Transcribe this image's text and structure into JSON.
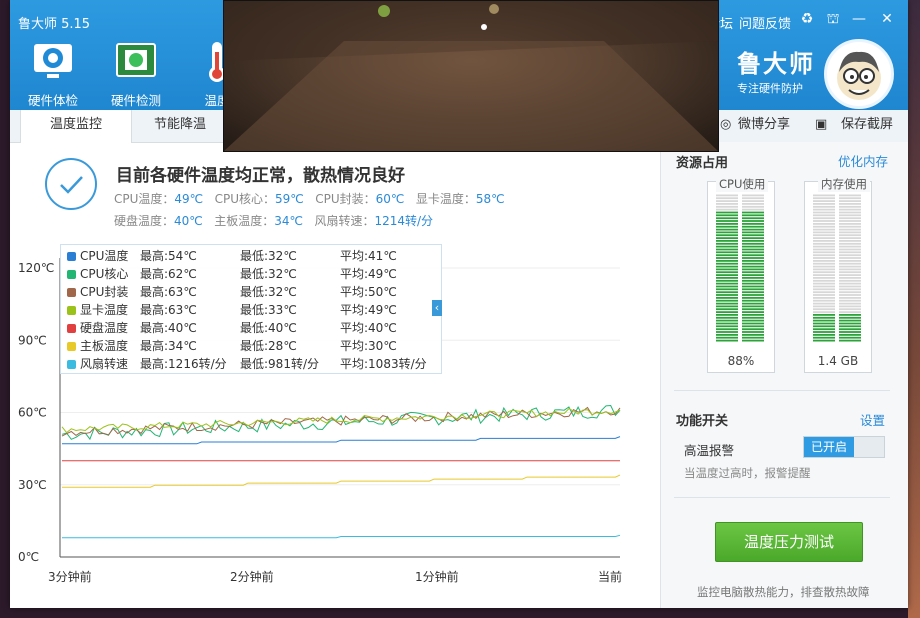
{
  "app": {
    "title": "鲁大师 5.15",
    "brand": "鲁大师",
    "brand_sub": "专注硬件防护"
  },
  "nav": [
    {
      "label": "硬件体检",
      "icon": "monitor-check-icon"
    },
    {
      "label": "硬件检测",
      "icon": "circuit-board-icon"
    },
    {
      "label": "温度",
      "icon": "thermometer-icon"
    }
  ],
  "top_links": {
    "forum": "论坛",
    "feedback": "问题反馈"
  },
  "window_controls": [
    "recycle-icon",
    "shirt-icon",
    "minimize-icon",
    "close-icon"
  ],
  "tabs": [
    {
      "label": "温度监控",
      "active": true
    },
    {
      "label": "节能降温",
      "active": false
    }
  ],
  "tools": {
    "weibo_share": "微博分享",
    "save_screenshot": "保存截屏"
  },
  "status": {
    "title": "目前各硬件温度均正常，散热情况良好",
    "row1": [
      {
        "label": "CPU温度：",
        "value": "49℃"
      },
      {
        "label": "CPU核心：",
        "value": "59℃"
      },
      {
        "label": "CPU封装：",
        "value": "60℃"
      },
      {
        "label": "显卡温度：",
        "value": "58℃"
      }
    ],
    "row2": [
      {
        "label": "硬盘温度：",
        "value": "40℃"
      },
      {
        "label": "主板温度：",
        "value": "34℃"
      },
      {
        "label": "风扇转速：",
        "value": "1214转/分"
      }
    ]
  },
  "legend": [
    {
      "name": "CPU温度",
      "max": "最高:54℃",
      "min": "最低:32℃",
      "avg": "平均:41℃",
      "color": "#2a7fd4"
    },
    {
      "name": "CPU核心",
      "max": "最高:62℃",
      "min": "最低:32℃",
      "avg": "平均:49℃",
      "color": "#22b573"
    },
    {
      "name": "CPU封装",
      "max": "最高:63℃",
      "min": "最低:32℃",
      "avg": "平均:50℃",
      "color": "#a0674a"
    },
    {
      "name": "显卡温度",
      "max": "最高:63℃",
      "min": "最低:33℃",
      "avg": "平均:49℃",
      "color": "#9bc21a"
    },
    {
      "name": "硬盘温度",
      "max": "最高:40℃",
      "min": "最低:40℃",
      "avg": "平均:40℃",
      "color": "#e04040"
    },
    {
      "name": "主板温度",
      "max": "最高:34℃",
      "min": "最低:28℃",
      "avg": "平均:30℃",
      "color": "#e8c92a"
    },
    {
      "name": "风扇转速",
      "max": "最高:1216转/分",
      "min": "最低:981转/分",
      "avg": "平均:1083转/分",
      "color": "#3bbbe0"
    }
  ],
  "chart_data": {
    "type": "line",
    "ylim": [
      0,
      120
    ],
    "yticks": [
      "120℃",
      "90℃",
      "60℃",
      "30℃",
      "0℃"
    ],
    "xticks": [
      "3分钟前",
      "2分钟前",
      "1分钟前",
      "当前"
    ],
    "series": [
      {
        "name": "CPU温度",
        "start": 47,
        "end": 50,
        "noise": 0
      },
      {
        "name": "CPU核心",
        "start": 51,
        "end": 61,
        "noise": 3
      },
      {
        "name": "CPU封装",
        "start": 52,
        "end": 61,
        "noise": 2
      },
      {
        "name": "显卡温度",
        "start": 53,
        "end": 61,
        "noise": 1.5
      },
      {
        "name": "硬盘温度",
        "start": 40,
        "end": 40,
        "noise": 0
      },
      {
        "name": "主板温度",
        "start": 29,
        "end": 34,
        "noise": 0
      },
      {
        "name": "风扇转速",
        "start": 8,
        "end": 9,
        "noise": 0
      }
    ]
  },
  "sidebar": {
    "resources_title": "资源占用",
    "optimize_link": "优化内存",
    "cpu": {
      "label": "CPU使用",
      "value": "88%",
      "fraction": 0.88
    },
    "mem": {
      "label": "内存使用",
      "value": "1.4 GB",
      "fraction": 0.19
    },
    "features_title": "功能开关",
    "settings_link": "设置",
    "alarm_label": "高温报警",
    "alarm_state": "已开启",
    "alarm_desc": "当温度过高时，报警提醒",
    "stress_button": "温度压力测试",
    "stress_desc": "监控电脑散热能力，排查散热故障"
  }
}
